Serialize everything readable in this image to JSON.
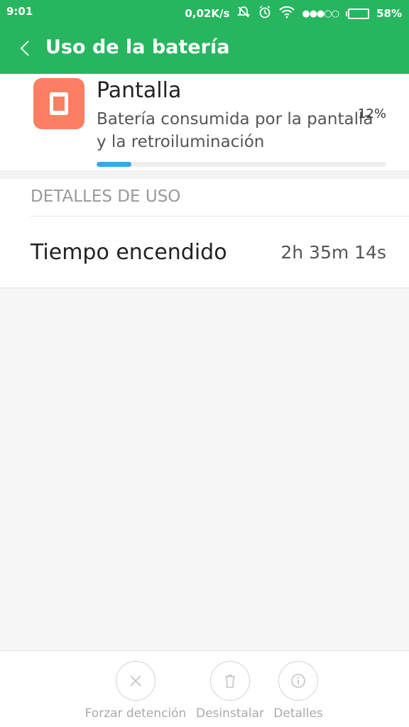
{
  "status_bar": {
    "time": "9:01",
    "network_speed": "0,02K/s",
    "battery_percent": "58%",
    "battery_level": 0.58,
    "signal_dots": "●●●○○",
    "icons": [
      "mute-icon",
      "alarm-icon",
      "wifi-icon",
      "signal-icon",
      "battery-icon"
    ]
  },
  "app_bar": {
    "back_icon": "chevron-left-icon",
    "title": "Uso de la batería"
  },
  "app_card": {
    "icon": "tablet-icon",
    "icon_color": "#fa7f63",
    "name": "Pantalla",
    "description": "Batería consumida por la pantalla y la retroiluminación",
    "percent": "12%",
    "usage_fraction": 0.12,
    "bar_color": "#38a6f0"
  },
  "details": {
    "header": "DETALLES DE USO",
    "rows": [
      {
        "label": "Tiempo encendido",
        "value": "2h 35m 14s"
      }
    ]
  },
  "actions": [
    {
      "label": "Forzar detención",
      "icon": "close-icon"
    },
    {
      "label": "Desinstalar",
      "icon": "trash-icon"
    },
    {
      "label": "Detalles",
      "icon": "info-icon"
    }
  ],
  "colors": {
    "accent": "#27b65f"
  }
}
